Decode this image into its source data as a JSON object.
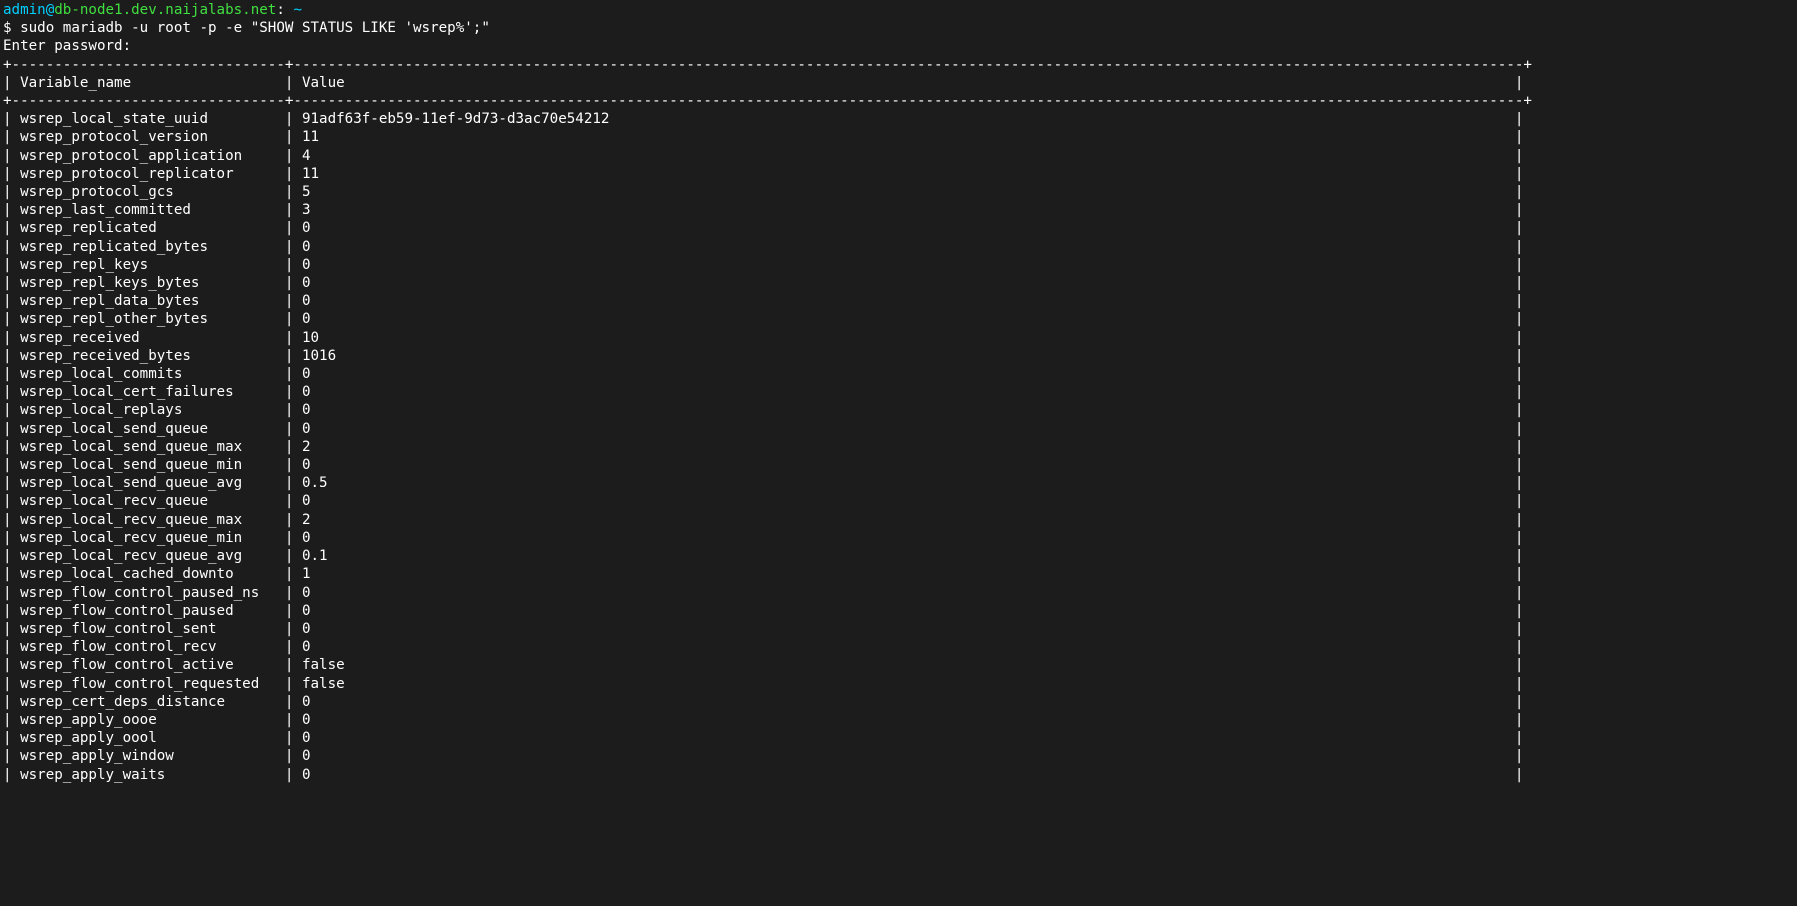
{
  "prompt": {
    "user": "admin",
    "at": "@",
    "host": "db-node1.dev.naijalabs.net",
    "sep": ":",
    "path": " ~",
    "ps2": "$ ",
    "command": "sudo mariadb -u root -p -e \"SHOW STATUS LIKE 'wsrep%';\"",
    "enter_pw": "Enter password:"
  },
  "table": {
    "col1_header": "Variable_name",
    "col2_header": "Value",
    "rows": [
      {
        "name": "wsrep_local_state_uuid",
        "value": "91adf63f-eb59-11ef-9d73-d3ac70e54212"
      },
      {
        "name": "wsrep_protocol_version",
        "value": "11"
      },
      {
        "name": "wsrep_protocol_application",
        "value": "4"
      },
      {
        "name": "wsrep_protocol_replicator",
        "value": "11"
      },
      {
        "name": "wsrep_protocol_gcs",
        "value": "5"
      },
      {
        "name": "wsrep_last_committed",
        "value": "3"
      },
      {
        "name": "wsrep_replicated",
        "value": "0"
      },
      {
        "name": "wsrep_replicated_bytes",
        "value": "0"
      },
      {
        "name": "wsrep_repl_keys",
        "value": "0"
      },
      {
        "name": "wsrep_repl_keys_bytes",
        "value": "0"
      },
      {
        "name": "wsrep_repl_data_bytes",
        "value": "0"
      },
      {
        "name": "wsrep_repl_other_bytes",
        "value": "0"
      },
      {
        "name": "wsrep_received",
        "value": "10"
      },
      {
        "name": "wsrep_received_bytes",
        "value": "1016"
      },
      {
        "name": "wsrep_local_commits",
        "value": "0"
      },
      {
        "name": "wsrep_local_cert_failures",
        "value": "0"
      },
      {
        "name": "wsrep_local_replays",
        "value": "0"
      },
      {
        "name": "wsrep_local_send_queue",
        "value": "0"
      },
      {
        "name": "wsrep_local_send_queue_max",
        "value": "2"
      },
      {
        "name": "wsrep_local_send_queue_min",
        "value": "0"
      },
      {
        "name": "wsrep_local_send_queue_avg",
        "value": "0.5"
      },
      {
        "name": "wsrep_local_recv_queue",
        "value": "0"
      },
      {
        "name": "wsrep_local_recv_queue_max",
        "value": "2"
      },
      {
        "name": "wsrep_local_recv_queue_min",
        "value": "0"
      },
      {
        "name": "wsrep_local_recv_queue_avg",
        "value": "0.1"
      },
      {
        "name": "wsrep_local_cached_downto",
        "value": "1"
      },
      {
        "name": "wsrep_flow_control_paused_ns",
        "value": "0"
      },
      {
        "name": "wsrep_flow_control_paused",
        "value": "0"
      },
      {
        "name": "wsrep_flow_control_sent",
        "value": "0"
      },
      {
        "name": "wsrep_flow_control_recv",
        "value": "0"
      },
      {
        "name": "wsrep_flow_control_active",
        "value": "false"
      },
      {
        "name": "wsrep_flow_control_requested",
        "value": "false"
      },
      {
        "name": "wsrep_cert_deps_distance",
        "value": "0"
      },
      {
        "name": "wsrep_apply_oooe",
        "value": "0"
      },
      {
        "name": "wsrep_apply_oool",
        "value": "0"
      },
      {
        "name": "wsrep_apply_window",
        "value": "0"
      },
      {
        "name": "wsrep_apply_waits",
        "value": "0"
      }
    ]
  },
  "layout": {
    "col1_width": 32,
    "total_width": 178
  }
}
